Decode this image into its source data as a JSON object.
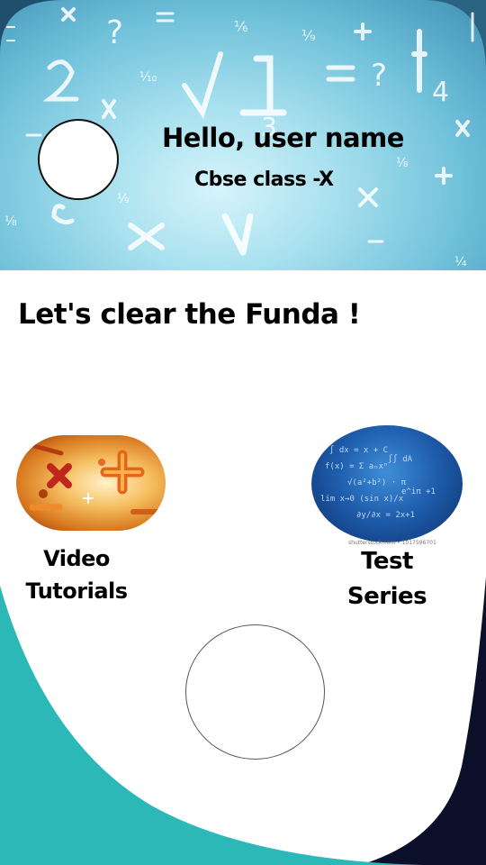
{
  "header": {
    "greeting": "Hello, user name",
    "class_info": "Cbse class -X"
  },
  "tagline": "Let's clear the Funda !",
  "cards": [
    {
      "label_line1": "Video",
      "label_line2": "Tutorials"
    },
    {
      "label_line1": "Test",
      "label_line2": "Series"
    }
  ],
  "test_image_caption": "shutterstock.com • 1017596701",
  "colors": {
    "header_light": "#a9e1ef",
    "header_dark": "#2a5f7f",
    "teal_accent": "#2db8b8",
    "navy_accent": "#0c0f2a"
  }
}
